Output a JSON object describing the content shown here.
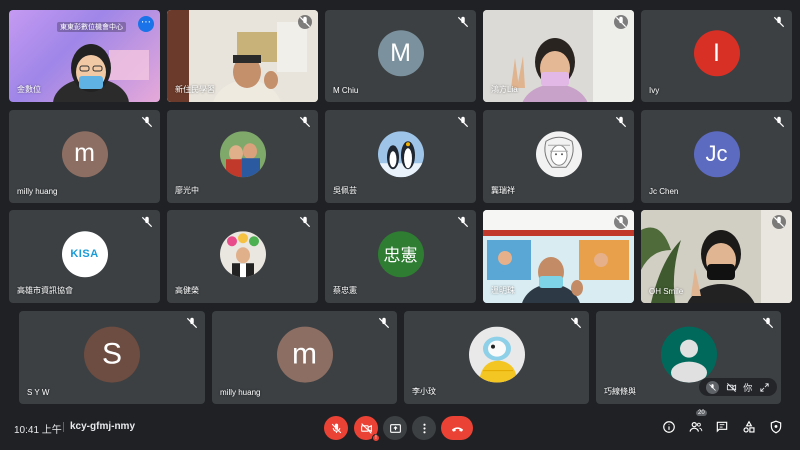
{
  "meeting": {
    "time": "10:41 上午",
    "code": "kcy-gfmj-nmy",
    "participant_count": "20",
    "self_label": "你"
  },
  "tiles": [
    {
      "name": "金數位",
      "kind": "video",
      "badge": "東東彭數位機會中心"
    },
    {
      "name": "新住民學習",
      "kind": "video"
    },
    {
      "name": "M Chiu",
      "kind": "avatar",
      "letter": "M",
      "color": "#7b919d"
    },
    {
      "name": "鴻方Lia",
      "kind": "video"
    },
    {
      "name": "Ivy",
      "kind": "avatar",
      "letter": "I",
      "color": "#d93025"
    },
    {
      "name": "milly huang",
      "kind": "avatar",
      "letter": "m",
      "color": "#8d6e63"
    },
    {
      "name": "廖光中",
      "kind": "photo"
    },
    {
      "name": "吳佩芸",
      "kind": "photo"
    },
    {
      "name": "龔瑞祥",
      "kind": "photo"
    },
    {
      "name": "Jc Chen",
      "kind": "avatar",
      "letter": "Jc",
      "color": "#5c6bc0"
    },
    {
      "name": "高雄市資訊協會",
      "kind": "logo",
      "logo_text": "KISA"
    },
    {
      "name": "高健榮",
      "kind": "photo"
    },
    {
      "name": "蔡忠憲",
      "kind": "avatar",
      "letter": "忠憲",
      "color": "#2e7d32"
    },
    {
      "name": "溫明珠",
      "kind": "video"
    },
    {
      "name": "OH Smile",
      "kind": "video"
    },
    {
      "name": "S Y W",
      "kind": "avatar",
      "letter": "S",
      "color": "#6d4c41"
    },
    {
      "name": "milly huang",
      "kind": "avatar",
      "letter": "m",
      "color": "#8d6e63"
    },
    {
      "name": "李小玟",
      "kind": "photo"
    },
    {
      "name": "巧線條與",
      "kind": "avatar",
      "letter": "",
      "color": "#00695c"
    }
  ],
  "colors": {
    "background": "#202124",
    "tile": "#3c4043",
    "danger": "#ea4335",
    "accent": "#1a73e8"
  },
  "icons": [
    "mic-off-icon",
    "camera-off-icon",
    "present-icon",
    "more-icon",
    "hangup-icon",
    "info-icon",
    "people-icon",
    "chat-icon",
    "activities-icon",
    "host-controls-icon"
  ]
}
